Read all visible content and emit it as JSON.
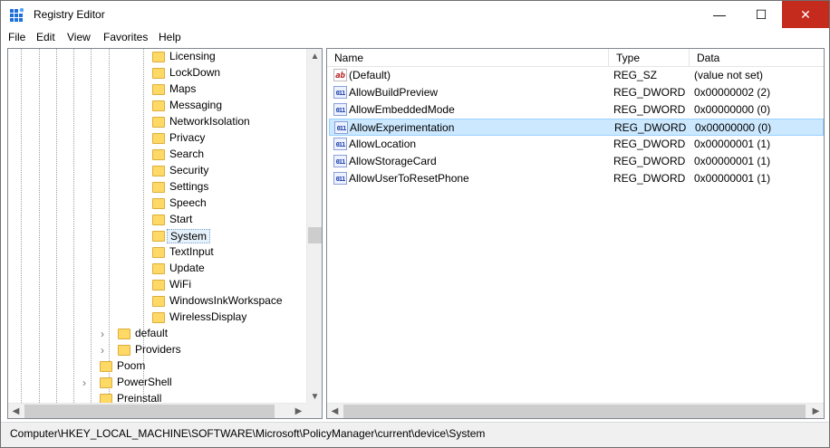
{
  "window": {
    "title": "Registry Editor",
    "minimize_glyph": "—",
    "maximize_glyph": "☐",
    "close_glyph": "✕"
  },
  "menu": [
    "File",
    "Edit",
    "View",
    "Favorites",
    "Help"
  ],
  "tree": {
    "selected": "System",
    "items": [
      {
        "label": "Licensing",
        "level": 3
      },
      {
        "label": "LockDown",
        "level": 3
      },
      {
        "label": "Maps",
        "level": 3
      },
      {
        "label": "Messaging",
        "level": 3
      },
      {
        "label": "NetworkIsolation",
        "level": 3
      },
      {
        "label": "Privacy",
        "level": 3
      },
      {
        "label": "Search",
        "level": 3
      },
      {
        "label": "Security",
        "level": 3
      },
      {
        "label": "Settings",
        "level": 3
      },
      {
        "label": "Speech",
        "level": 3
      },
      {
        "label": "Start",
        "level": 3
      },
      {
        "label": "System",
        "level": 3
      },
      {
        "label": "TextInput",
        "level": 3
      },
      {
        "label": "Update",
        "level": 3
      },
      {
        "label": "WiFi",
        "level": 3
      },
      {
        "label": "WindowsInkWorkspace",
        "level": 3
      },
      {
        "label": "WirelessDisplay",
        "level": 3
      },
      {
        "label": "default",
        "level": 2,
        "expandable": true
      },
      {
        "label": "Providers",
        "level": 2,
        "expandable": true
      },
      {
        "label": "Poom",
        "level": 1
      },
      {
        "label": "PowerShell",
        "level": 1,
        "expandable": true
      },
      {
        "label": "Preinstall",
        "level": 1
      }
    ]
  },
  "columns": {
    "name": "Name",
    "type": "Type",
    "data": "Data"
  },
  "values": [
    {
      "name": "(Default)",
      "type": "REG_SZ",
      "data": "(value not set)",
      "icon": "string-value-icon"
    },
    {
      "name": "AllowBuildPreview",
      "type": "REG_DWORD",
      "data": "0x00000002 (2)",
      "icon": "dword-value-icon"
    },
    {
      "name": "AllowEmbeddedMode",
      "type": "REG_DWORD",
      "data": "0x00000000 (0)",
      "icon": "dword-value-icon"
    },
    {
      "name": "AllowExperimentation",
      "type": "REG_DWORD",
      "data": "0x00000000 (0)",
      "icon": "dword-value-icon",
      "selected": true
    },
    {
      "name": "AllowLocation",
      "type": "REG_DWORD",
      "data": "0x00000001 (1)",
      "icon": "dword-value-icon"
    },
    {
      "name": "AllowStorageCard",
      "type": "REG_DWORD",
      "data": "0x00000001 (1)",
      "icon": "dword-value-icon"
    },
    {
      "name": "AllowUserToResetPhone",
      "type": "REG_DWORD",
      "data": "0x00000001 (1)",
      "icon": "dword-value-icon"
    }
  ],
  "status": {
    "path": "Computer\\HKEY_LOCAL_MACHINE\\SOFTWARE\\Microsoft\\PolicyManager\\current\\device\\System"
  },
  "colors": {
    "close_button": "#c42b1c",
    "selection": "#cce8ff",
    "folder": "#ffd966"
  }
}
